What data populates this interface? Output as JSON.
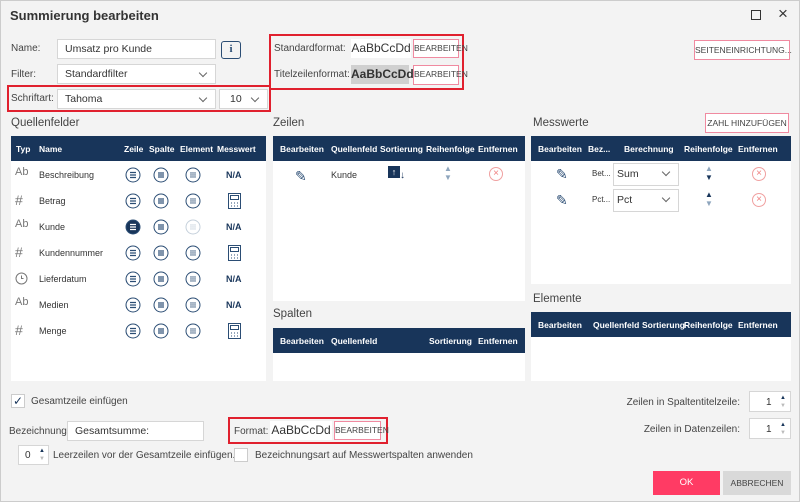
{
  "window": {
    "title": "Summierung bearbeiten"
  },
  "form": {
    "name_label": "Name:",
    "name_value": "Umsatz pro Kunde",
    "filter_label": "Filter:",
    "filter_value": "Standardfilter",
    "font_label": "Schriftart:",
    "font_value": "Tahoma",
    "size_value": "10"
  },
  "formats": {
    "standard_label": "Standardformat:",
    "title_label": "Titelzeilenformat:",
    "sample": "AaBbCcDd",
    "edit": "BEARBEITEN"
  },
  "page_setup": "SEITENEINRICHTUNG...",
  "sources": {
    "heading": "Quellenfelder",
    "columns": [
      "Typ",
      "Name",
      "Zeile",
      "Spalte",
      "Element",
      "Messwert"
    ],
    "rows": [
      {
        "type": "Ab",
        "name": "Beschreibung",
        "measure": "N/A"
      },
      {
        "type": "#",
        "name": "Betrag",
        "measure": "calc"
      },
      {
        "type": "Ab",
        "name": "Kunde",
        "measure": "N/A",
        "active": true
      },
      {
        "type": "#",
        "name": "Kundennummer",
        "measure": "calc"
      },
      {
        "type": "clock",
        "name": "Lieferdatum",
        "measure": "N/A"
      },
      {
        "type": "Ab",
        "name": "Medien",
        "measure": "N/A"
      },
      {
        "type": "#",
        "name": "Menge",
        "measure": "calc"
      }
    ]
  },
  "rows_panel": {
    "heading": "Zeilen",
    "columns": [
      "Bearbeiten",
      "Quellenfeld",
      "Sortierung",
      "Reihenfolge",
      "Entfernen"
    ],
    "items": [
      {
        "field": "Kunde"
      }
    ]
  },
  "columns_panel": {
    "heading": "Spalten",
    "columns": [
      "Bearbeiten",
      "Quellenfeld",
      "Sortierung",
      "Entfernen"
    ]
  },
  "measures": {
    "heading": "Messwerte",
    "add": "ZAHL HINZUFÜGEN",
    "columns": [
      "Bearbeiten",
      "Bez...",
      "Berechnung",
      "Reihenfolge",
      "Entfernen"
    ],
    "items": [
      {
        "name": "Bet...",
        "calc": "Sum"
      },
      {
        "name": "Pct...",
        "calc": "Pct"
      }
    ]
  },
  "elements": {
    "heading": "Elemente",
    "columns": [
      "Bearbeiten",
      "Quellenfeld",
      "Sortierung",
      "Reihenfolge",
      "Entfernen"
    ]
  },
  "totals": {
    "include_label": "Gesamtzeile einfügen",
    "include_checked": true,
    "label_label": "Bezeichnung:",
    "label_value": "Gesamtsumme:",
    "format_label": "Format:",
    "blank_value": "0",
    "blank_label": "Leerzeilen vor der Gesamtzeile einfügen.",
    "apply_label": "Bezeichnungsart auf Messwertspalten anwenden"
  },
  "right": {
    "header_rows_label": "Zeilen in Spaltentitelzeile:",
    "header_rows": "1",
    "data_rows_label": "Zeilen in Datenzeilen:",
    "data_rows": "1"
  },
  "buttons": {
    "ok": "OK",
    "cancel": "ABBRECHEN"
  },
  "colors": {
    "header": "#18355a",
    "accent": "#ff3b64"
  }
}
